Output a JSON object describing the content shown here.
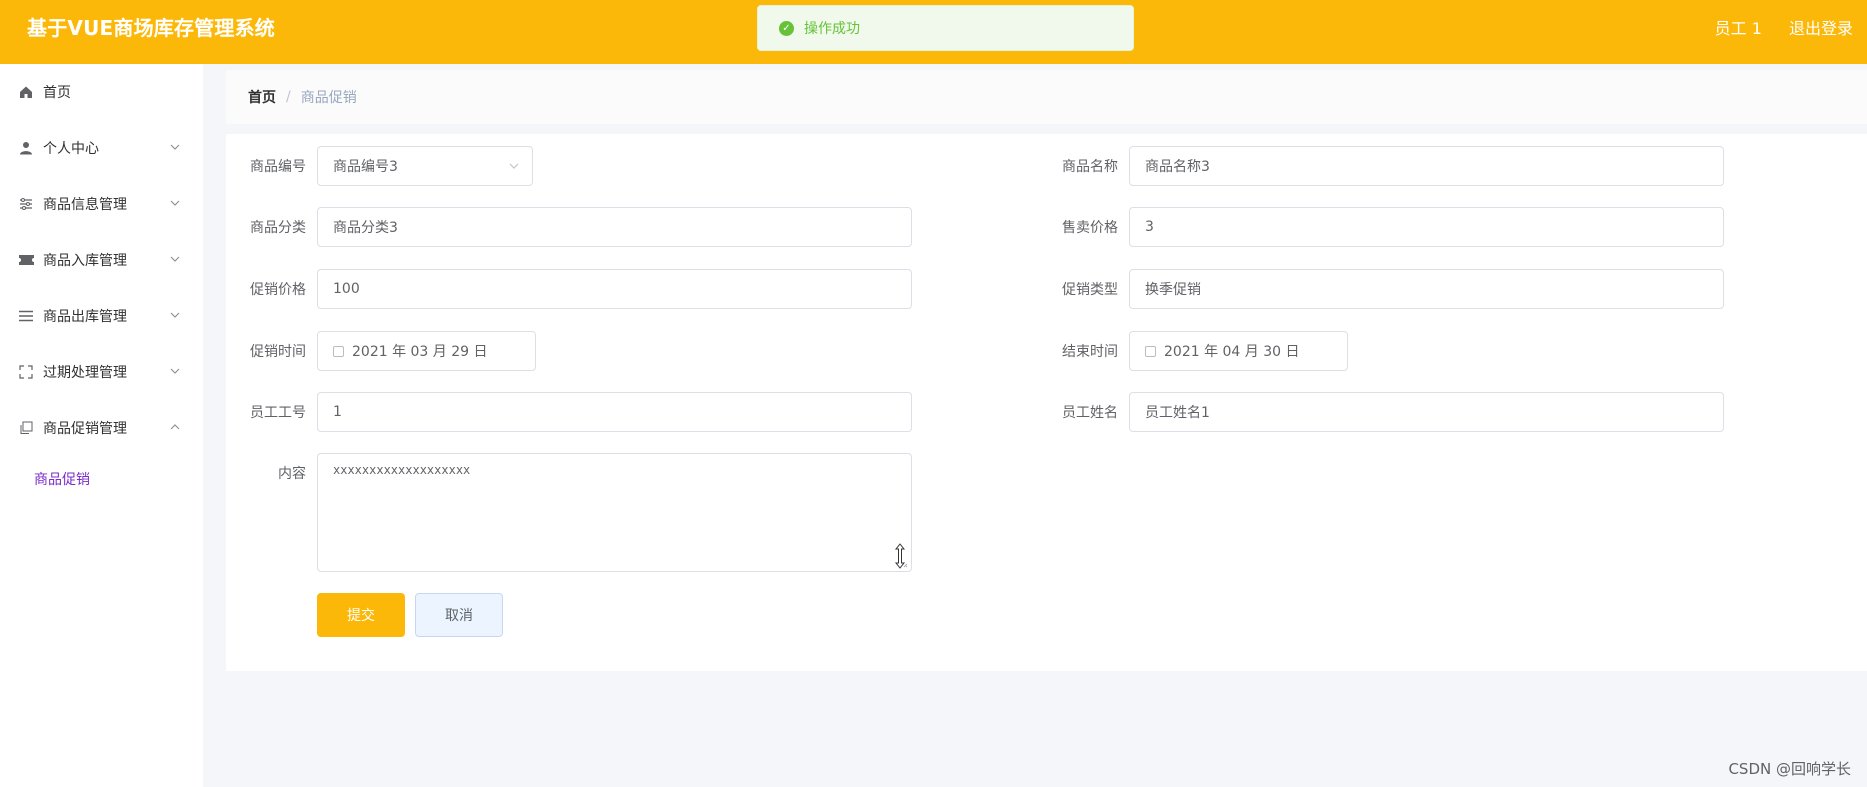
{
  "header": {
    "title": "基于VUE商场库存管理系统",
    "user": "员工 1",
    "logout": "退出登录"
  },
  "toast": {
    "message": "操作成功",
    "icon": "success-check-icon",
    "color": "#67c23a"
  },
  "sidebar": {
    "items": [
      {
        "label": "首页",
        "icon": "home-icon"
      },
      {
        "label": "个人中心",
        "icon": "user-icon"
      },
      {
        "label": "商品信息管理",
        "icon": "sliders-icon"
      },
      {
        "label": "商品入库管理",
        "icon": "ticket-icon"
      },
      {
        "label": "商品出库管理",
        "icon": "list-icon"
      },
      {
        "label": "过期处理管理",
        "icon": "fullscreen-icon"
      },
      {
        "label": "商品促销管理",
        "icon": "copy-icon"
      }
    ],
    "subitem": "商品促销"
  },
  "breadcrumb": {
    "home": "首页",
    "separator": "/",
    "current": "商品促销"
  },
  "form": {
    "product_code": {
      "label": "商品编号",
      "value": "商品编号3"
    },
    "product_name": {
      "label": "商品名称",
      "value": "商品名称3"
    },
    "category": {
      "label": "商品分类",
      "value": "商品分类3"
    },
    "sale_price": {
      "label": "售卖价格",
      "value": "3"
    },
    "promo_price": {
      "label": "促销价格",
      "value": "100"
    },
    "promo_type": {
      "label": "促销类型",
      "value": "换季促销"
    },
    "promo_time": {
      "label": "促销时间",
      "value": "2021 年 03 月 29 日"
    },
    "end_time": {
      "label": "结束时间",
      "value": "2021 年 04 月 30 日"
    },
    "employee_id": {
      "label": "员工工号",
      "value": "1"
    },
    "employee_name": {
      "label": "员工姓名",
      "value": "员工姓名1"
    },
    "content": {
      "label": "内容",
      "value": "xxxxxxxxxxxxxxxxxxx"
    }
  },
  "buttons": {
    "submit": "提交",
    "cancel": "取消"
  },
  "watermark": "CSDN @回响学长",
  "colors": {
    "accent": "#fbb808",
    "active_submenu": "#7c2cc8"
  }
}
